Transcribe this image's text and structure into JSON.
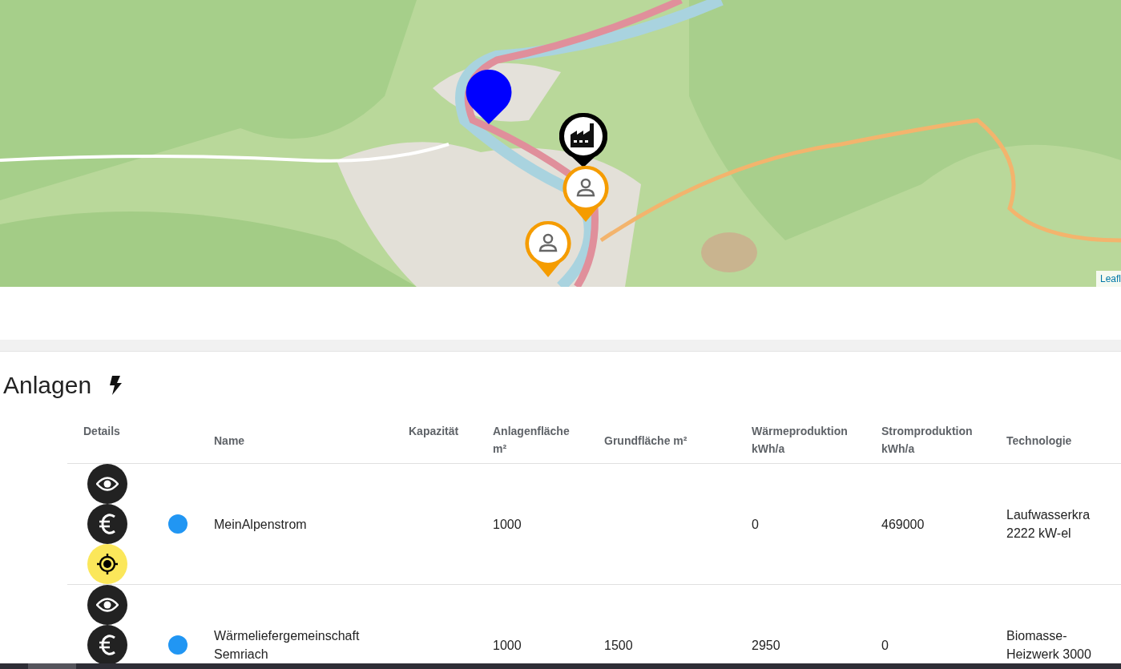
{
  "map": {
    "markers": [
      {
        "kind": "pin"
      },
      {
        "kind": "factory"
      },
      {
        "kind": "person"
      },
      {
        "kind": "person"
      }
    ],
    "attribution": "Leafl"
  },
  "section": {
    "title": "Anlagen"
  },
  "table": {
    "columns": [
      {
        "label": "Details"
      },
      {
        "label": "Name"
      },
      {
        "label": "Kapazität"
      },
      {
        "label": "Anlagenfläche m²"
      },
      {
        "label": "Grundfläche m²"
      },
      {
        "label": "Wärmeproduktion kWh/a"
      },
      {
        "label": "Stromproduktion kWh/a"
      },
      {
        "label": "Technologie"
      }
    ],
    "rows": [
      {
        "actions": [
          {
            "kind": "view"
          },
          {
            "kind": "cost"
          },
          {
            "kind": "locate"
          }
        ],
        "color": "#2196f3",
        "cells": {
          "name": "MeinAlpenstrom",
          "area": "1000",
          "heat": "0",
          "power": "469000",
          "technology": "Laufwasserkra 2222 kW-el"
        }
      },
      {
        "actions": [
          {
            "kind": "view"
          },
          {
            "kind": "cost"
          }
        ],
        "color": "#2196f3",
        "cells": {
          "name": "Wärmeliefergemeinschaft Semriach",
          "area": "1000",
          "ground": "1500",
          "heat": "2950",
          "power": "0",
          "technology": "Biomasse-Heizwerk 3000"
        }
      }
    ]
  }
}
